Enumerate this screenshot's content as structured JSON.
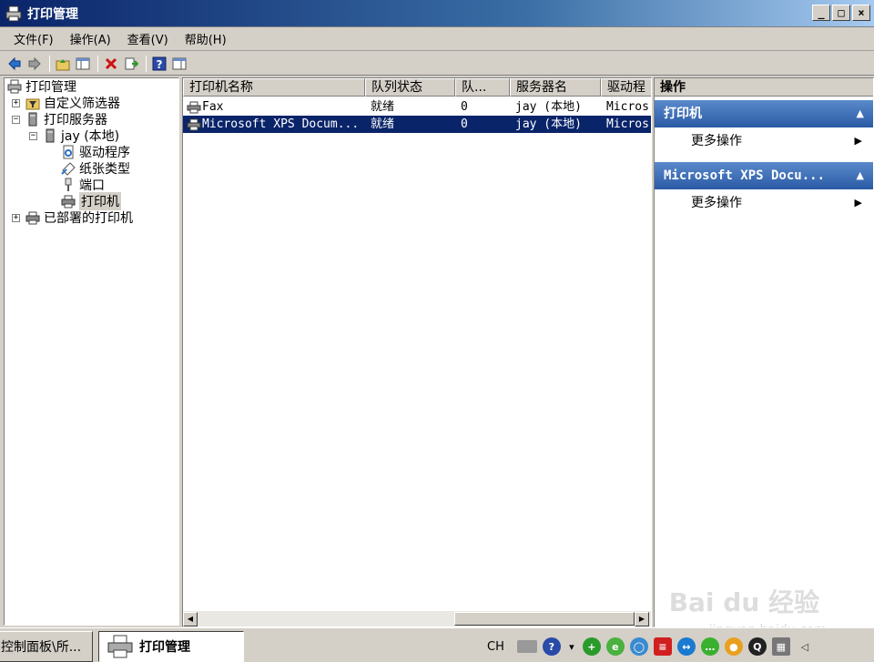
{
  "window": {
    "title": "打印管理",
    "minimize": "_",
    "maximize": "□",
    "close": "×"
  },
  "menu": [
    "文件(F)",
    "操作(A)",
    "查看(V)",
    "帮助(H)"
  ],
  "tree": {
    "root": "打印管理",
    "custom_filters": "自定义筛选器",
    "print_servers": "打印服务器",
    "server": "jay (本地)",
    "drivers": "驱动程序",
    "forms": "纸张类型",
    "ports": "端口",
    "printers": "打印机",
    "deployed": "已部署的打印机"
  },
  "list": {
    "columns": [
      "打印机名称",
      "队列状态",
      "队...",
      "服务器名",
      "驱动程"
    ],
    "rows": [
      {
        "name": "Fax",
        "status": "就绪",
        "jobs": "0",
        "server": "jay (本地)",
        "driver": "Micros"
      },
      {
        "name": "Microsoft XPS Docum...",
        "status": "就绪",
        "jobs": "0",
        "server": "jay (本地)",
        "driver": "Micros"
      }
    ]
  },
  "actions": {
    "header": "操作",
    "section1": "打印机",
    "section1_more": "更多操作",
    "section2": "Microsoft XPS Docu...",
    "section2_more": "更多操作"
  },
  "taskbar": {
    "task1": "控制面板\\所...",
    "task2": "打印管理",
    "lang": "CH"
  },
  "watermark": {
    "brand": "Bai du 经验",
    "url": "jingyan.baidu.com"
  }
}
